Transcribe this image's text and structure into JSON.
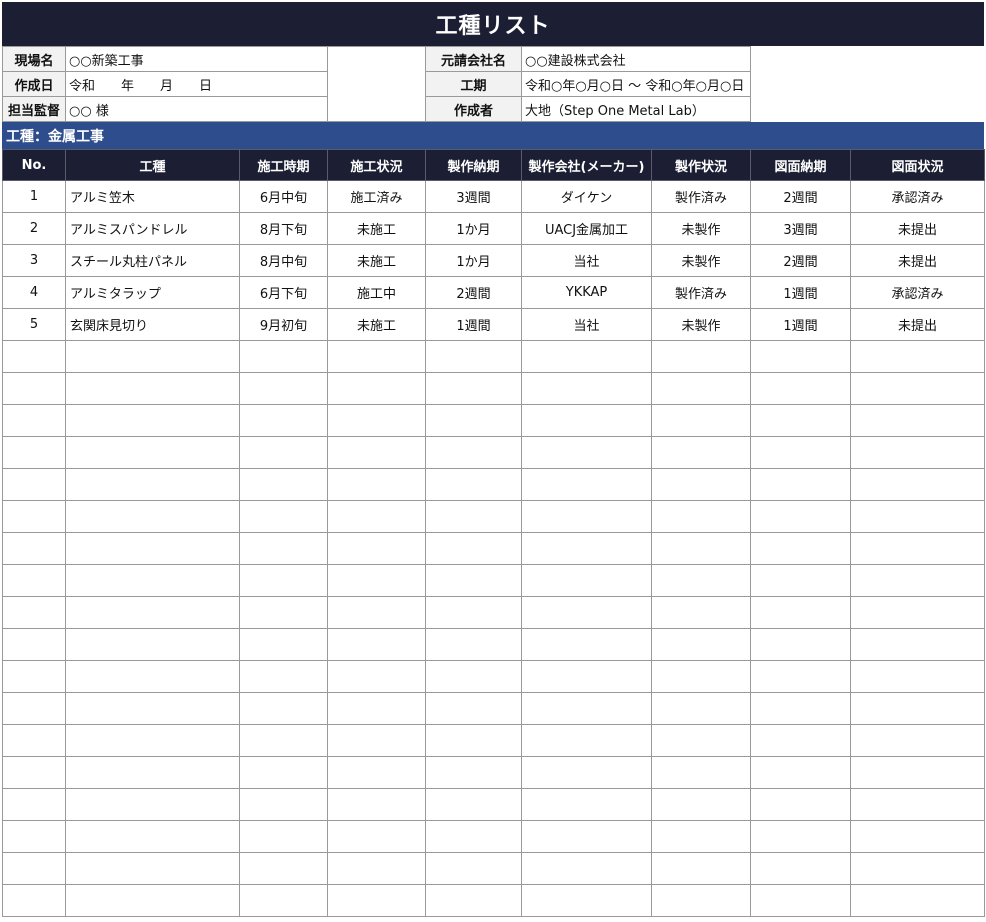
{
  "title": "工種リスト",
  "info": {
    "site_label": "現場名",
    "site_value": "○○新築工事",
    "date_label": "作成日",
    "date_value": "令和　　年　　月　　日",
    "supervisor_label": "担当監督",
    "supervisor_value": "○○ 様",
    "contractor_label": "元請会社名",
    "contractor_value": "○○建設株式会社",
    "period_label": "工期",
    "period_value": "令和○年○月○日 〜 令和○年○月○日",
    "author_label": "作成者",
    "author_value": "大地（Step One Metal Lab）"
  },
  "section_title": "工種：金属工事",
  "columns": [
    "No.",
    "工種",
    "施工時期",
    "施工状況",
    "製作納期",
    "製作会社(メーカー)",
    "製作状況",
    "図面納期",
    "図面状況"
  ],
  "rows": [
    [
      "1",
      "アルミ笠木",
      "6月中旬",
      "施工済み",
      "3週間",
      "ダイケン",
      "製作済み",
      "2週間",
      "承認済み"
    ],
    [
      "2",
      "アルミスパンドレル",
      "8月下旬",
      "未施工",
      "1か月",
      "UACJ金属加工",
      "未製作",
      "3週間",
      "未提出"
    ],
    [
      "3",
      "スチール丸柱パネル",
      "8月中旬",
      "未施工",
      "1か月",
      "当社",
      "未製作",
      "2週間",
      "未提出"
    ],
    [
      "4",
      "アルミタラップ",
      "6月下旬",
      "施工中",
      "2週間",
      "YKKAP",
      "製作済み",
      "1週間",
      "承認済み"
    ],
    [
      "5",
      "玄関床見切り",
      "9月初旬",
      "未施工",
      "1週間",
      "当社",
      "未製作",
      "1週間",
      "未提出"
    ]
  ],
  "empty_row_count": 18
}
